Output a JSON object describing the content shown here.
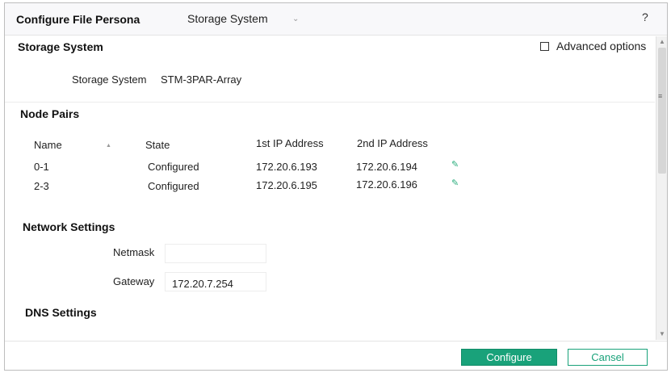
{
  "header": {
    "title": "Configure File Persona",
    "section_selector": "Storage System",
    "help_label": "?"
  },
  "storage_system": {
    "heading": "Storage System",
    "advanced_options_label": "Advanced options",
    "advanced_options_checked": false,
    "field_label": "Storage System",
    "field_value": "STM-3PAR-Array"
  },
  "node_pairs": {
    "heading": "Node Pairs",
    "columns": [
      "Name",
      "State",
      "1st IP Address",
      "2nd IP Address"
    ],
    "rows": [
      {
        "name": "0-1",
        "state": "Configured",
        "ip1": "172.20.6.193",
        "ip2": "172.20.6.194"
      },
      {
        "name": "2-3",
        "state": "Configured",
        "ip1": "172.20.6.195",
        "ip2": "172.20.6.196"
      }
    ]
  },
  "network_settings": {
    "heading": "Network Settings",
    "netmask_label": "Netmask",
    "netmask_value": "",
    "gateway_label": "Gateway",
    "gateway_value": "172.20.7.254"
  },
  "dns_settings": {
    "heading": "DNS Settings"
  },
  "footer": {
    "configure_label": "Configure",
    "cancel_label": "Cansel"
  },
  "colors": {
    "accent": "#19a27a",
    "edit_icon": "#2bad7d"
  },
  "icons": {
    "edit": "pencil-icon",
    "sort": "sort-ascending-icon",
    "dropdown": "chevron-down-icon"
  }
}
